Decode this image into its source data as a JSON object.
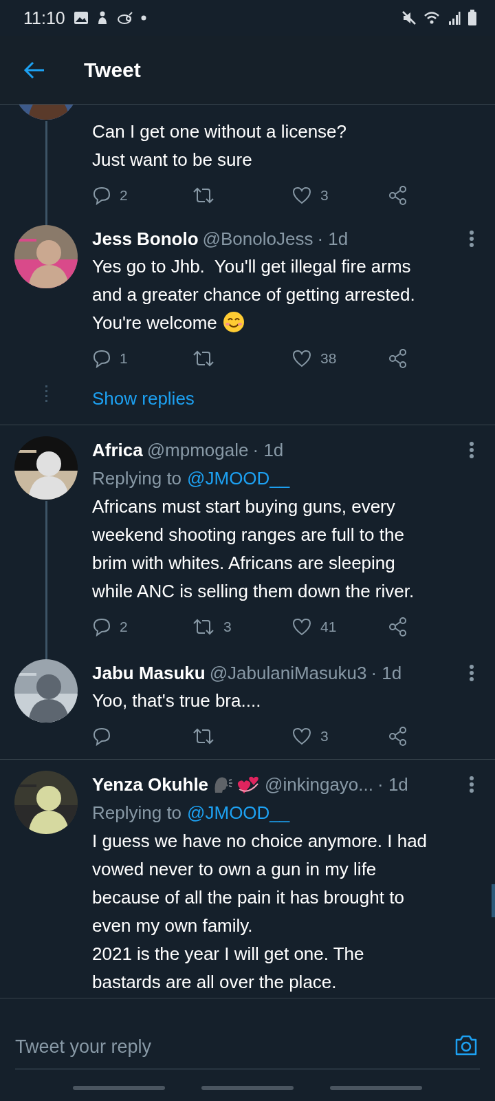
{
  "status_bar": {
    "time": "11:10"
  },
  "header": {
    "title": "Tweet"
  },
  "tweets": [
    {
      "body": "Can I get one without a license?\nJust want to be sure",
      "thread_line": true,
      "actions": {
        "replies": "2",
        "likes": "3"
      }
    },
    {
      "name": "Jess Bonolo",
      "handle": "@BonoloJess",
      "time": "· 1d",
      "body": "Yes go to Jhb.  You'll get illegal fire arms\nand a greater chance of getting arrested.\nYou're welcome",
      "trailing_emoji": true,
      "actions": {
        "replies": "1",
        "likes": "38"
      },
      "show_replies": "Show replies"
    },
    {
      "name": "Africa",
      "handle": "@mpmogale",
      "time": "· 1d",
      "replying_label": "Replying to",
      "replying_to": "@JMOOD__",
      "body": "Africans must start buying guns, every\nweekend shooting ranges are full to the\nbrim with whites. Africans are sleeping\nwhile ANC is selling them down the river.",
      "thread_line": true,
      "actions": {
        "replies": "2",
        "retweets": "3",
        "likes": "41"
      }
    },
    {
      "name": "Jabu Masuku",
      "handle": "@JabulaniMasuku3",
      "time": "· 1d",
      "body": "Yoo, that's true bra....",
      "actions": {
        "likes": "3"
      }
    },
    {
      "name": "Yenza Okuhle",
      "name_emojis": true,
      "handle": "@inkingayo...",
      "time": "· 1d",
      "replying_label": "Replying to",
      "replying_to": "@JMOOD__",
      "body": "I guess we have no choice anymore. I had\nvowed never to own a gun in my life\nbecause of all the pain it has brought to\neven my own family.\n2021 is the year I will get one. The\nbastards are all over the place."
    }
  ],
  "composer": {
    "placeholder": "Tweet your reply"
  }
}
